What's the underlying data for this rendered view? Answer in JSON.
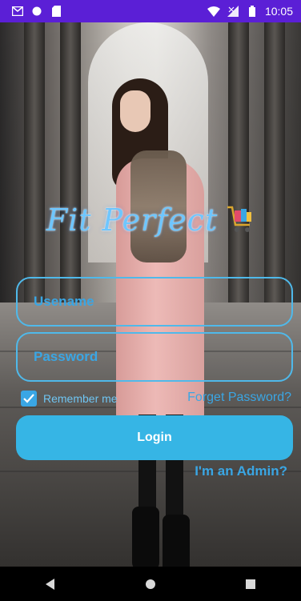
{
  "status_bar": {
    "time": "10:05",
    "icons": [
      "gmail-icon",
      "circle-icon",
      "sd-card-icon",
      "wifi-icon",
      "signal-icon",
      "battery-icon"
    ],
    "background_color": "#5b1fd6"
  },
  "logo": {
    "text": "Fit Perfect",
    "cart_icon": "shopping-cart-icon",
    "color": "#6ec6ff"
  },
  "form": {
    "username_placeholder": "Usename",
    "password_placeholder": "Password",
    "remember_label": "Remember me",
    "remember_checked": true,
    "forget_label": "Forget Password?",
    "login_label": "Login",
    "admin_label": "I'm an Admin?",
    "accent_color": "#36b5e5"
  },
  "nav_bar": {
    "back": "back-icon",
    "home": "home-icon",
    "recents": "recents-icon"
  }
}
